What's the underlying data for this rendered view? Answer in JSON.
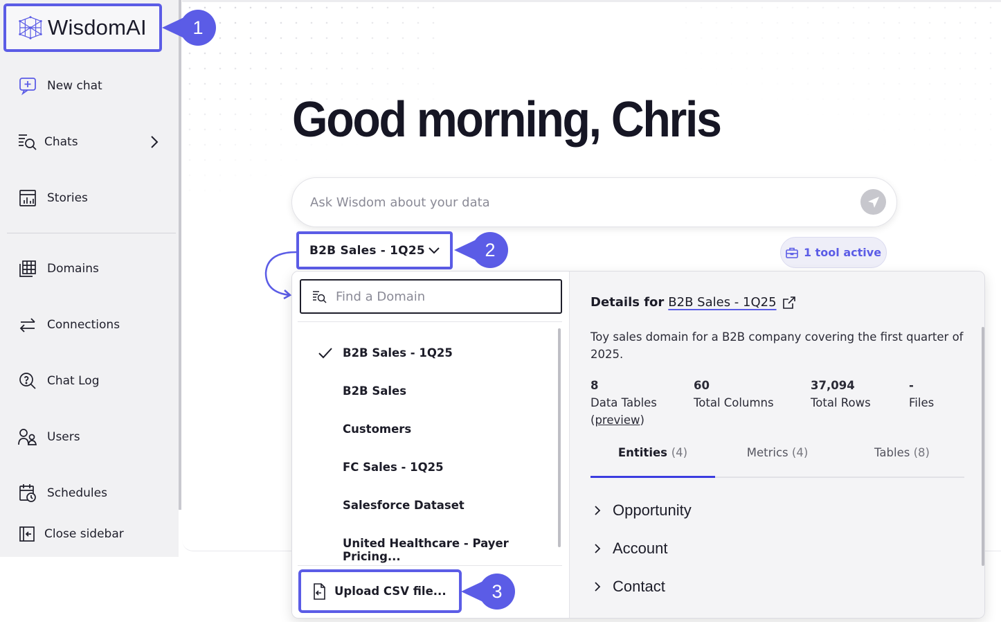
{
  "brand": {
    "name": "WisdomAI",
    "accent": "#5b5ce6"
  },
  "sidebar": {
    "items": [
      {
        "label": "New chat",
        "icon": "new-chat-icon"
      },
      {
        "label": "Chats",
        "icon": "chats-search-icon"
      },
      {
        "label": "Stories",
        "icon": "stories-chart-icon"
      },
      {
        "label": "Domains",
        "icon": "domains-table-icon"
      },
      {
        "label": "Connections",
        "icon": "connections-arrows-icon"
      },
      {
        "label": "Chat Log",
        "icon": "chat-log-icon"
      },
      {
        "label": "Users",
        "icon": "users-icon"
      },
      {
        "label": "Schedules",
        "icon": "schedules-calendar-icon"
      }
    ],
    "close_label": "Close sidebar"
  },
  "main": {
    "greeting": "Good morning, Chris",
    "ask_placeholder": "Ask Wisdom about your data",
    "selected_domain": "B2B Sales - 1Q25",
    "tool_status": "1 tool active"
  },
  "callouts": [
    "1",
    "2",
    "3"
  ],
  "domain_picker": {
    "search_placeholder": "Find a Domain",
    "options": [
      "B2B Sales - 1Q25",
      "B2B Sales",
      "Customers",
      "FC Sales - 1Q25",
      "Salesforce Dataset",
      "United Healthcare - Payer Pricing..."
    ],
    "selected_index": 0,
    "upload_label": "Upload CSV file..."
  },
  "details": {
    "title_prefix": "Details for",
    "domain_link": "B2B Sales - 1Q25",
    "description": "Toy sales domain for a B2B company covering the first quarter of 2025.",
    "stats": [
      {
        "value": "8",
        "label": "Data Tables",
        "extra": "preview"
      },
      {
        "value": "60",
        "label": "Total Columns"
      },
      {
        "value": "37,094",
        "label": "Total Rows"
      },
      {
        "value": "-",
        "label": "Files"
      }
    ],
    "tabs": [
      {
        "label": "Entities",
        "count": "(4)"
      },
      {
        "label": "Metrics",
        "count": "(4)"
      },
      {
        "label": "Tables",
        "count": "(8)"
      }
    ],
    "active_tab": 0,
    "entities": [
      "Opportunity",
      "Account",
      "Contact"
    ]
  }
}
